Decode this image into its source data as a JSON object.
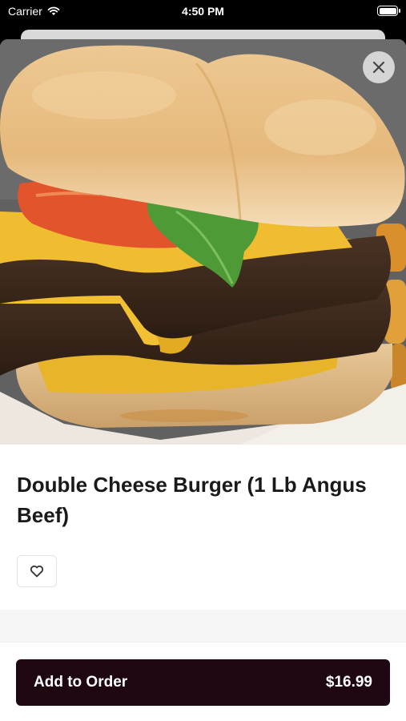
{
  "status_bar": {
    "carrier": "Carrier",
    "time": "4:50 PM"
  },
  "product": {
    "title": "Double Cheese Burger (1 Lb Angus Beef)",
    "image_icon": "burger-photo"
  },
  "icons": {
    "close": "close-icon",
    "favorite": "heart-icon",
    "wifi": "wifi-icon",
    "battery": "battery-icon"
  },
  "footer": {
    "add_label": "Add to Order",
    "price": "$16.99"
  },
  "colors": {
    "button_bg": "#1e0712",
    "sheet_bg": "#ffffff",
    "divider_bg": "#f6f6f6"
  }
}
